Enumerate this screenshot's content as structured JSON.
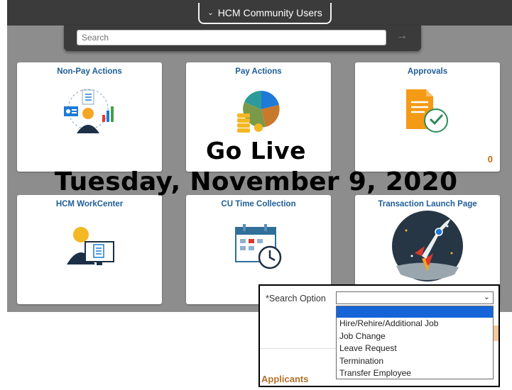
{
  "header": {
    "title": "HCM Community Users",
    "chevron": "chevron-down-icon"
  },
  "search": {
    "placeholder": "Search",
    "arrow": "arrow-right-icon"
  },
  "tiles": [
    {
      "title": "Non-Pay Actions",
      "icon": "person-documents-icon"
    },
    {
      "title": "Pay Actions",
      "icon": "pie-chart-coins-icon"
    },
    {
      "title": "Approvals",
      "icon": "document-check-icon",
      "count": "0"
    },
    {
      "title": "HCM WorkCenter",
      "icon": "person-monitor-icon"
    },
    {
      "title": "CU Time Collection",
      "icon": "calendar-clock-icon"
    },
    {
      "title": "Transaction Launch Page",
      "icon": "rocket-icon"
    }
  ],
  "announcement": {
    "headline": "Go Live",
    "date": "Tuesday, November 9, 2020"
  },
  "popup": {
    "label": "*Search Option",
    "selected_value": "",
    "options": [
      "",
      "Hire/Rehire/Additional Job",
      "Job Change",
      "Leave Request",
      "Termination",
      "Transfer Employee"
    ],
    "section": "Applicants"
  }
}
